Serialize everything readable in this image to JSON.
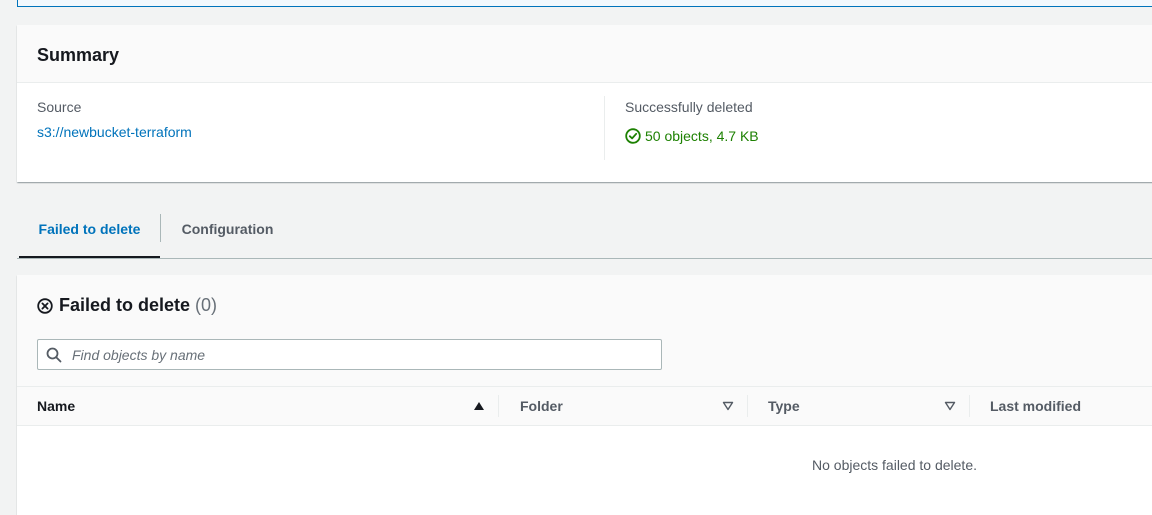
{
  "summary": {
    "title": "Summary",
    "source_label": "Source",
    "source_value": "s3://newbucket-terraform",
    "deleted_label": "Successfully deleted",
    "deleted_value": "50 objects, 4.7 KB",
    "success_color": "#1d8102"
  },
  "tabs": [
    {
      "label": "Failed to delete",
      "active": true
    },
    {
      "label": "Configuration",
      "active": false
    }
  ],
  "failed": {
    "title": "Failed to delete",
    "count": "(0)",
    "search_placeholder": "Find objects by name",
    "columns": [
      "Name",
      "Folder",
      "Type",
      "Last modified"
    ],
    "empty_message": "No objects failed to delete."
  },
  "colors": {
    "accent": "#0073bb",
    "text": "#16191f",
    "muted": "#545b64"
  },
  "icons": [
    "success-check-icon",
    "failed-x-icon",
    "search-icon",
    "sort-ascending-icon",
    "sort-descending-icon"
  ]
}
